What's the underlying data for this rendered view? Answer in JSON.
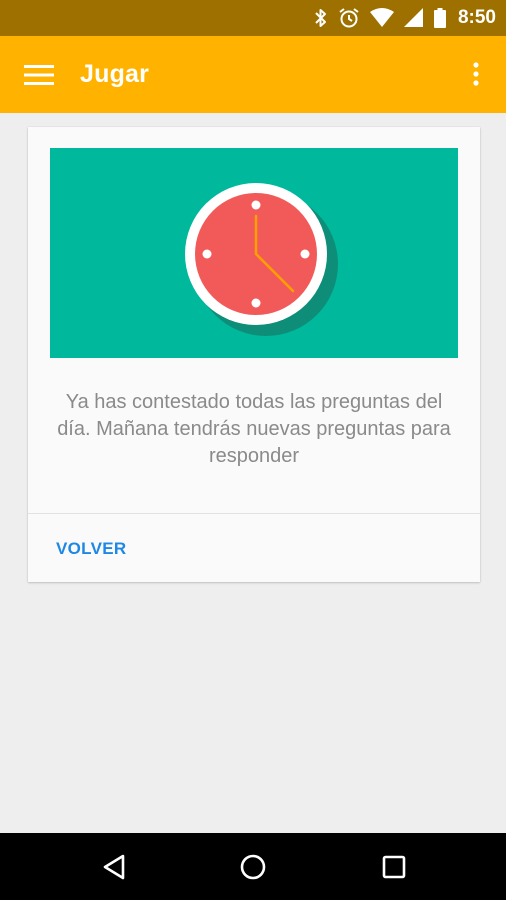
{
  "status_bar": {
    "time": "8:50",
    "icons": [
      "bluetooth-icon",
      "alarm-icon",
      "wifi-icon",
      "signal-icon",
      "battery-icon"
    ],
    "background": "#9e7000"
  },
  "app_bar": {
    "title": "Jugar",
    "menu_icon": "hamburger-menu-icon",
    "overflow_icon": "more-vert-icon",
    "background": "#ffb300"
  },
  "card": {
    "illustration": "clock-icon",
    "banner_color": "#00b89c",
    "clock_color": "#f15a58",
    "hand_color": "#ffa000",
    "message": "Ya has contestado todas las preguntas del día. Mañana tendrás nuevas preguntas para responder",
    "action_label": "VOLVER",
    "action_color": "#1e88e5"
  },
  "nav_bar": {
    "icons": [
      "back-icon",
      "home-icon",
      "recents-icon"
    ]
  }
}
